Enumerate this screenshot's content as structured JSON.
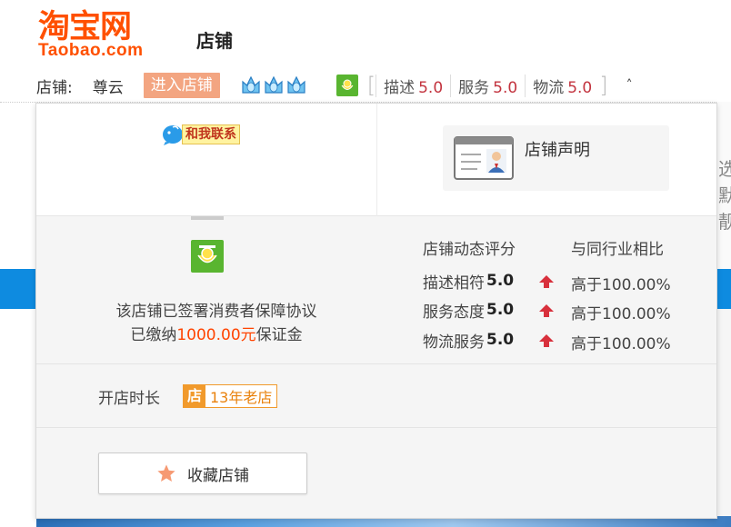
{
  "header": {
    "logo_cn": "淘宝网",
    "logo_en": "Taobao.com",
    "title": "店铺"
  },
  "shopbar": {
    "label": "店铺:",
    "shop_name": "尊云",
    "enter_button": "进入店铺",
    "crown_count": 3,
    "ratings": [
      {
        "label": "描述",
        "value": "5.0"
      },
      {
        "label": "服务",
        "value": "5.0"
      },
      {
        "label": "物流",
        "value": "5.0"
      }
    ],
    "caret": "˄"
  },
  "panel": {
    "contact_label": "和我联系",
    "declaration_label": "店铺声明",
    "protection": {
      "line1": "该店铺已签署消费者保障协议",
      "line2_prefix": "已缴纳",
      "deposit_amount": "1000.00元",
      "line2_suffix": "保证金"
    },
    "dsr": {
      "header_left": "店铺动态评分",
      "header_right": "与同行业相比",
      "rows": [
        {
          "label": "描述相符",
          "score": "5.0",
          "compare": "高于100.00%"
        },
        {
          "label": "服务态度",
          "score": "5.0",
          "compare": "高于100.00%"
        },
        {
          "label": "物流服务",
          "score": "5.0",
          "compare": "高于100.00%"
        }
      ]
    },
    "open_duration": {
      "label": "开店时长",
      "badge_icon": "店",
      "badge_text": "13年老店"
    },
    "favorite_button": "收藏店铺"
  },
  "background": {
    "right_text": "选默靓"
  },
  "colors": {
    "brand_orange": "#ff5000",
    "enter_button_bg": "#f3a581",
    "rating_red": "#c3343f",
    "deposit_red": "#ff4400",
    "badge_orange": "#f19a2c",
    "guard_green": "#59b530"
  },
  "icons": {
    "crown": "blue-crown-icon",
    "guard": "consumer-guarantee-icon",
    "contact": "wangwang-bubble-icon",
    "declaration": "id-card-icon",
    "arrow": "red-up-arrow-icon",
    "star": "star-icon"
  }
}
